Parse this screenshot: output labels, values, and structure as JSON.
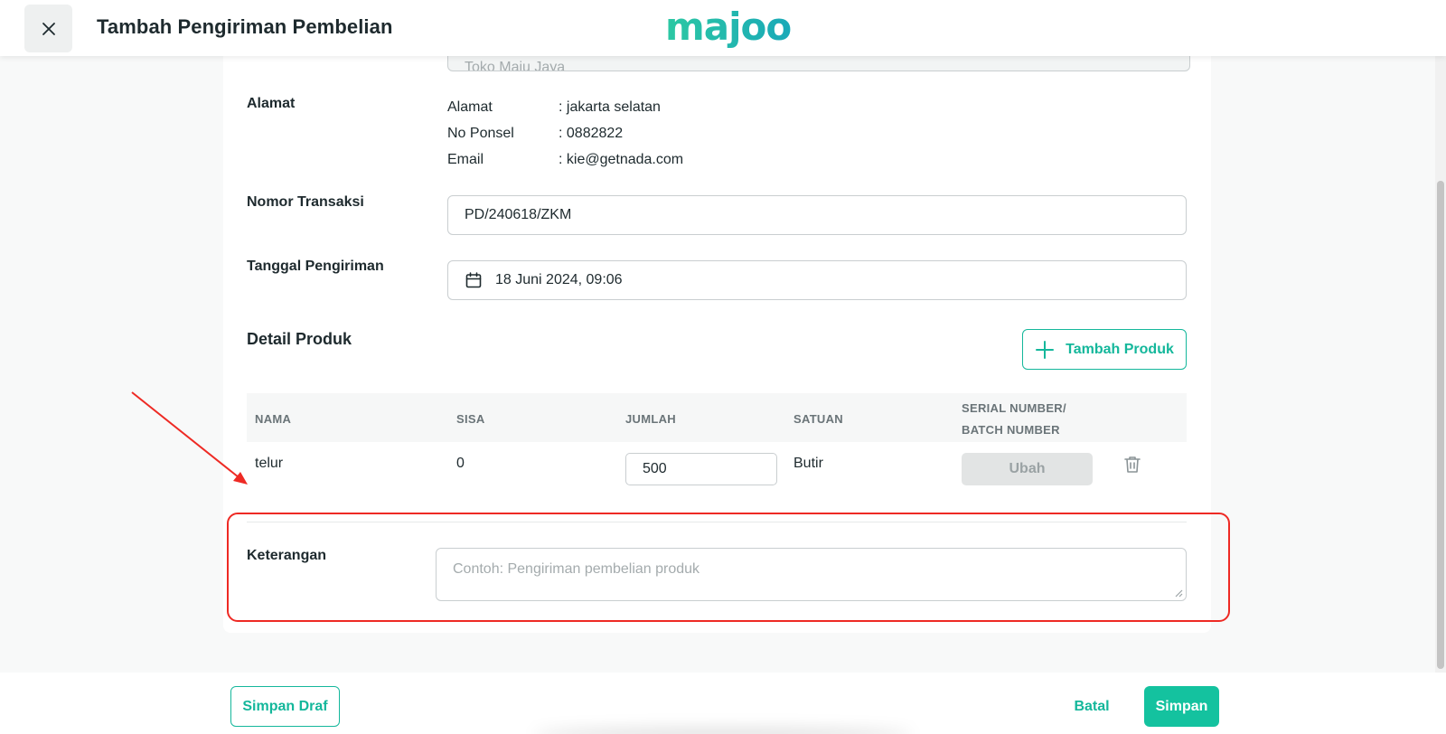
{
  "header": {
    "title": "Tambah Pengiriman Pembelian",
    "logo_text": "majoo"
  },
  "form": {
    "top_field_value": "Toko Maju Jaya",
    "address": {
      "label": "Alamat",
      "rows": [
        {
          "key": "Alamat",
          "value": ": jakarta selatan"
        },
        {
          "key": "No Ponsel",
          "value": ": 0882822"
        },
        {
          "key": "Email",
          "value": ": kie@getnada.com"
        }
      ]
    },
    "transaction": {
      "label": "Nomor Transaksi",
      "value": "PD/240618/ZKM"
    },
    "ship_date": {
      "label": "Tanggal Pengiriman",
      "value": "18 Juni 2024, 09:06"
    },
    "products": {
      "section_title": "Detail Produk",
      "add_button": "Tambah Produk",
      "columns": {
        "name": "NAMA",
        "stock": "SISA",
        "qty": "JUMLAH",
        "unit": "SATUAN",
        "serial_line1": "SERIAL NUMBER/",
        "serial_line2": "BATCH NUMBER"
      },
      "rows": [
        {
          "name": "telur",
          "stock": "0",
          "qty": "500",
          "unit": "Butir",
          "action": "Ubah"
        }
      ]
    },
    "notes": {
      "label": "Keterangan",
      "placeholder": "Contoh: Pengiriman pembelian produk"
    }
  },
  "footer": {
    "draft_label": "Simpan Draf",
    "cancel_label": "Batal",
    "save_label": "Simpan"
  },
  "colors": {
    "accent": "#14b79b",
    "highlight": "#ee2a24"
  }
}
